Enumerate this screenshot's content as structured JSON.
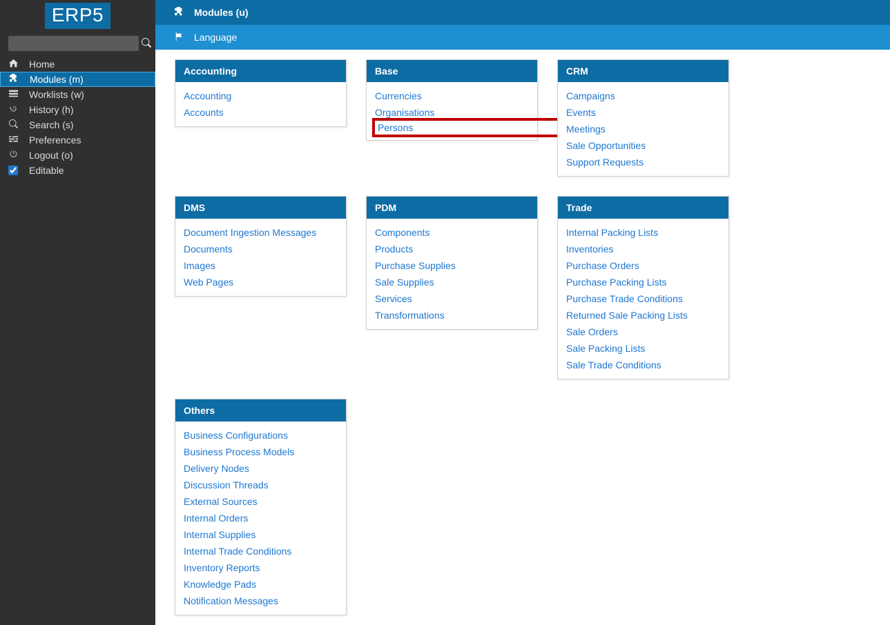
{
  "logo": "ERP5",
  "search": {
    "placeholder": ""
  },
  "sidebar": {
    "items": [
      {
        "icon": "home",
        "label": "Home"
      },
      {
        "icon": "puzzle",
        "label": "Modules (m)"
      },
      {
        "icon": "list",
        "label": "Worklists (w)"
      },
      {
        "icon": "history",
        "label": "History (h)"
      },
      {
        "icon": "search",
        "label": "Search (s)"
      },
      {
        "icon": "sliders",
        "label": "Preferences"
      },
      {
        "icon": "power",
        "label": "Logout (o)"
      }
    ],
    "editable_label": "Editable"
  },
  "topbar": {
    "modules_label": "Modules (u)",
    "language_label": "Language"
  },
  "modules": {
    "accounting": {
      "title": "Accounting",
      "items": [
        "Accounting",
        "Accounts"
      ]
    },
    "base": {
      "title": "Base",
      "items": [
        "Currencies",
        "Organisations",
        "Persons"
      ]
    },
    "crm": {
      "title": "CRM",
      "items": [
        "Campaigns",
        "Events",
        "Meetings",
        "Sale Opportunities",
        "Support Requests"
      ]
    },
    "dms": {
      "title": "DMS",
      "items": [
        "Document Ingestion Messages",
        "Documents",
        "Images",
        "Web Pages"
      ]
    },
    "pdm": {
      "title": "PDM",
      "items": [
        "Components",
        "Products",
        "Purchase Supplies",
        "Sale Supplies",
        "Services",
        "Transformations"
      ]
    },
    "trade": {
      "title": "Trade",
      "items": [
        "Internal Packing Lists",
        "Inventories",
        "Purchase Orders",
        "Purchase Packing Lists",
        "Purchase Trade Conditions",
        "Returned Sale Packing Lists",
        "Sale Orders",
        "Sale Packing Lists",
        "Sale Trade Conditions"
      ]
    },
    "others": {
      "title": "Others",
      "items": [
        "Business Configurations",
        "Business Process Models",
        "Delivery Nodes",
        "Discussion Threads",
        "External Sources",
        "Internal Orders",
        "Internal Supplies",
        "Internal Trade Conditions",
        "Inventory Reports",
        "Knowledge Pads",
        "Notification Messages"
      ]
    }
  }
}
